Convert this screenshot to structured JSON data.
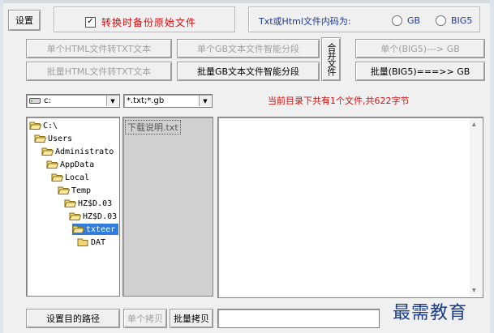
{
  "toolbar": {
    "settings_label": "设置",
    "backup_checkbox_label": "转换时备份原始文件",
    "backup_checked": true,
    "encoding_label": "Txt或Html文件内码为:",
    "encoding_options": [
      "GB",
      "BIG5"
    ]
  },
  "buttons": {
    "single_html_to_txt": "单个HTML文件转TXT文本",
    "single_gb_segment": "单个GB文本文件智能分段",
    "merge_files": "合并文件",
    "single_big5_to_gb": "单个(BIG5)---> GB",
    "batch_html_to_txt": "批量HTML文件转TXT文本",
    "batch_gb_segment": "批量GB文本文件智能分段",
    "batch_big5_to_gb": "批量(BIG5)===>> GB"
  },
  "filters": {
    "drive_value": "c:",
    "file_mask_value": "*.txt;*.gb",
    "status_text": "当前目录下共有1个文件,共622字节"
  },
  "dir_tree": [
    {
      "label": "C:\\"
    },
    {
      "label": "Users"
    },
    {
      "label": "Administrato"
    },
    {
      "label": "AppData"
    },
    {
      "label": "Local"
    },
    {
      "label": "Temp"
    },
    {
      "label": "HZ$D.03"
    },
    {
      "label": "HZ$D.03"
    },
    {
      "label": "txteer"
    },
    {
      "label": "DAT"
    }
  ],
  "file_list": [
    "下载说明.txt"
  ],
  "bottom": {
    "set_dest_path": "设置目的路径",
    "single_copy": "单个拷贝",
    "batch_copy": "批量拷贝"
  },
  "watermark": "最需教育",
  "colors": {
    "accent_red": "#d01010",
    "selection_blue": "#2f7de1",
    "watermark_blue": "#1a3d8b"
  }
}
